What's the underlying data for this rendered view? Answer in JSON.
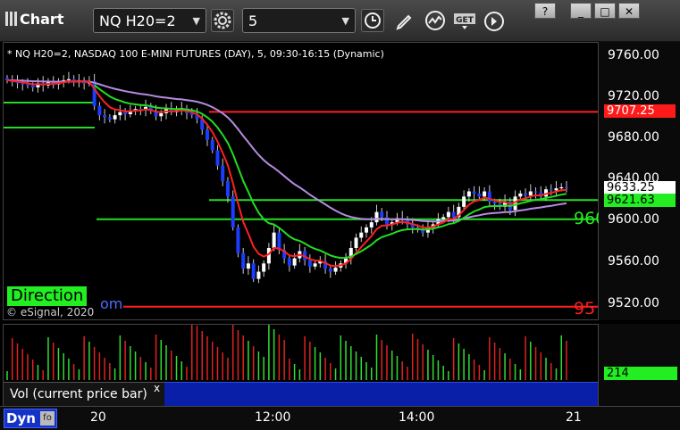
{
  "window": {
    "title": "Chart"
  },
  "toolbar": {
    "symbol_value": "NQ H20=2",
    "interval_value": "5",
    "get_label": "GET"
  },
  "chart": {
    "header": "* NQ H20=2, NASDAQ 100 E-MINI FUTURES (DAY), 5, 09:30-16:15 (Dynamic)",
    "watermark": "© eSignal, 2020",
    "direction_label": "Direction",
    "direction_suffix": "om",
    "level_600_label": "960",
    "level_520_label": "95",
    "price_labels": [
      "9760.00",
      "9720.00",
      "9680.00",
      "9640.00",
      "9600.00",
      "9560.00",
      "9520.00"
    ],
    "tags": {
      "red": "9707.25",
      "last": "9633.25",
      "green": "9621.63",
      "volume": "214"
    },
    "colors": {
      "up": "#ffffff",
      "down": "#1a3dff",
      "ema_red": "#ff2020",
      "ema_green": "#22dd22",
      "ma_purple": "#b48ce0"
    }
  },
  "volume_pane": {
    "label": "Vol (current price bar)",
    "close": "x"
  },
  "time_axis": {
    "dyn_label": "Dyn",
    "labels": [
      "20",
      "12:00",
      "14:00",
      "21"
    ]
  },
  "chart_data": {
    "type": "candlestick",
    "title": "* NQ H20=2, NASDAQ 100 E-MINI FUTURES (DAY), 5, 09:30-16:15 (Dynamic)",
    "x_ticks": [
      "20",
      "12:00",
      "14:00",
      "21"
    ],
    "y_ticks": [
      9760,
      9720,
      9680,
      9640,
      9600,
      9560,
      9520
    ],
    "ylim": [
      9510,
      9770
    ],
    "horizontal_levels": [
      {
        "price": 9707.25,
        "color": "red"
      },
      {
        "price": 9621.63,
        "color": "green"
      },
      {
        "price": 9603,
        "color": "green"
      },
      {
        "price": 9518,
        "color": "red"
      }
    ],
    "last_price": 9633.25,
    "last_volume": 214,
    "closes": [
      9738,
      9736,
      9735,
      9734,
      9733,
      9731,
      9735,
      9733,
      9736,
      9734,
      9737,
      9738,
      9739,
      9736,
      9738,
      9735,
      9737,
      9713,
      9704,
      9702,
      9700,
      9704,
      9707,
      9705,
      9708,
      9710,
      9709,
      9712,
      9708,
      9703,
      9706,
      9710,
      9707,
      9709,
      9711,
      9706,
      9704,
      9700,
      9690,
      9680,
      9670,
      9655,
      9640,
      9625,
      9595,
      9570,
      9555,
      9560,
      9545,
      9552,
      9560,
      9575,
      9590,
      9573,
      9565,
      9558,
      9565,
      9572,
      9563,
      9557,
      9560,
      9562,
      9555,
      9552,
      9556,
      9560,
      9565,
      9575,
      9585,
      9590,
      9595,
      9600,
      9610,
      9605,
      9598,
      9600,
      9604,
      9602,
      9598,
      9595,
      9593,
      9590,
      9595,
      9598,
      9603,
      9605,
      9610,
      9605,
      9615,
      9625,
      9630,
      9628,
      9625,
      9630,
      9620,
      9618,
      9615,
      9620,
      9612,
      9625,
      9628,
      9626,
      9630,
      9629,
      9625,
      9632,
      9631,
      9633,
      9634,
      9633
    ]
  }
}
